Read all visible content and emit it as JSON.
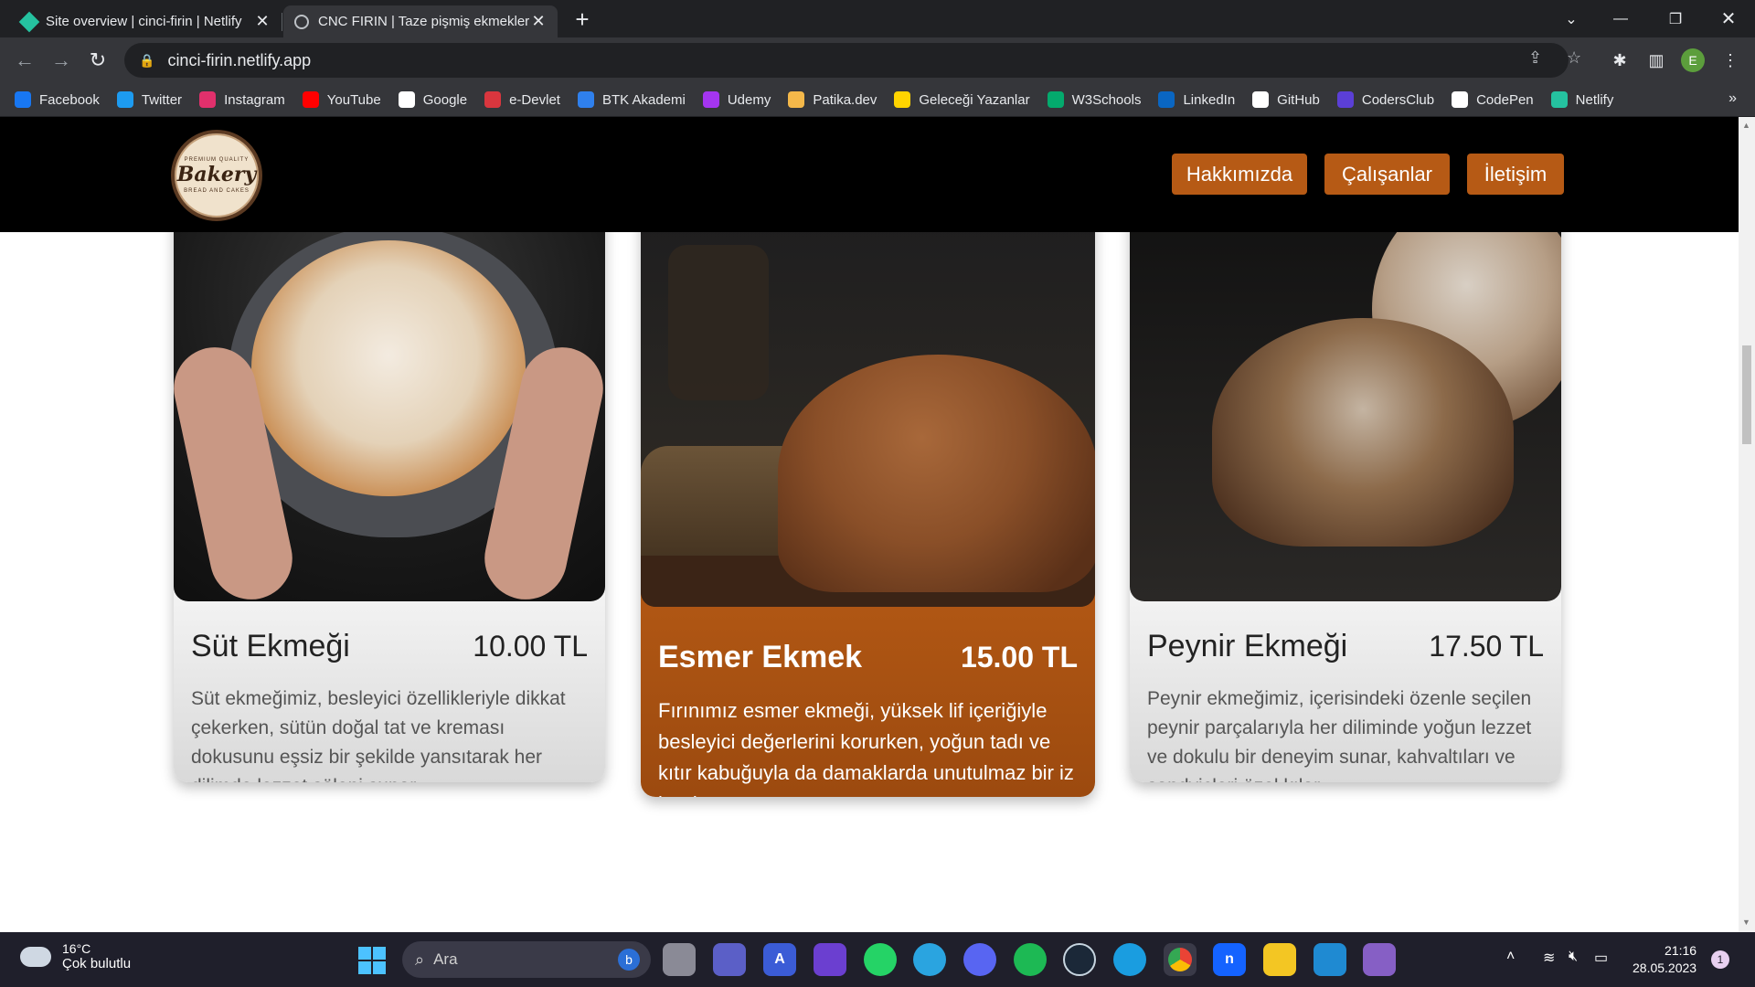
{
  "browser": {
    "tabs": [
      {
        "title": "Site overview | cinci-firin | Netlify",
        "active": false
      },
      {
        "title": "CNC FIRIN | Taze pişmiş ekmekler",
        "active": true
      }
    ],
    "url": "cinci-firin.netlify.app",
    "profile_initial": "E",
    "bookmarks": [
      {
        "label": "Facebook",
        "icon": "facebook-icon",
        "color": "#1877f2"
      },
      {
        "label": "Twitter",
        "icon": "twitter-icon",
        "color": "#1d9bf0"
      },
      {
        "label": "Instagram",
        "icon": "instagram-icon",
        "color": "#e1306c"
      },
      {
        "label": "YouTube",
        "icon": "youtube-icon",
        "color": "#ff0000"
      },
      {
        "label": "Google",
        "icon": "google-icon",
        "color": "#ffffff"
      },
      {
        "label": "e-Devlet",
        "icon": "edevlet-icon",
        "color": "#d9363e"
      },
      {
        "label": "BTK Akademi",
        "icon": "btk-icon",
        "color": "#2f80ed"
      },
      {
        "label": "Udemy",
        "icon": "udemy-icon",
        "color": "#a435f0"
      },
      {
        "label": "Patika.dev",
        "icon": "patika-icon",
        "color": "#f4b84a"
      },
      {
        "label": "Geleceği Yazanlar",
        "icon": "gelecegi-yazanlar-icon",
        "color": "#ffd400"
      },
      {
        "label": "W3Schools",
        "icon": "w3schools-icon",
        "color": "#04aa6d"
      },
      {
        "label": "LinkedIn",
        "icon": "linkedin-icon",
        "color": "#0a66c2"
      },
      {
        "label": "GitHub",
        "icon": "github-icon",
        "color": "#ffffff"
      },
      {
        "label": "CodersClub",
        "icon": "codersclub-icon",
        "color": "#5b3fd6"
      },
      {
        "label": "CodePen",
        "icon": "codepen-icon",
        "color": "#ffffff"
      },
      {
        "label": "Netlify",
        "icon": "netlify-icon",
        "color": "#25c2a0"
      }
    ]
  },
  "site": {
    "logo": {
      "top": "PREMIUM QUALITY",
      "main": "Bakery",
      "bottom": "BREAD AND CAKES"
    },
    "nav": [
      "Hakkımızda",
      "Çalışanlar",
      "İletişim"
    ],
    "accent": "#b65a15",
    "products": [
      {
        "name": "Süt Ekmeği",
        "price": "10.00 TL",
        "description": "Süt ekmeğimiz, besleyici özellikleriyle dikkat çekerken, sütün doğal tat ve kreması dokusunu eşsiz bir şekilde yansıtarak her dilimde lezzet şöleni sunar.",
        "featured": false
      },
      {
        "name": "Esmer Ekmek",
        "price": "15.00 TL",
        "description": "Fırınımız esmer ekmeği, yüksek lif içeriğiyle besleyici değerlerini korurken, yoğun tadı ve kıtır kabuğuyla da damaklarda unutulmaz bir iz bırakır.",
        "featured": true
      },
      {
        "name": "Peynir Ekmeği",
        "price": "17.50 TL",
        "description": "Peynir ekmeğimiz, içerisindeki özenle seçilen peynir parçalarıyla her diliminde yoğun lezzet ve dokulu bir deneyim sunar, kahvaltıları ve sandviçleri özel kılar.",
        "featured": false
      }
    ]
  },
  "taskbar": {
    "weather": {
      "temp": "16°C",
      "condition": "Çok bulutlu"
    },
    "search_placeholder": "Ara",
    "time": "21:16",
    "date": "28.05.2023",
    "notifications": "1"
  }
}
